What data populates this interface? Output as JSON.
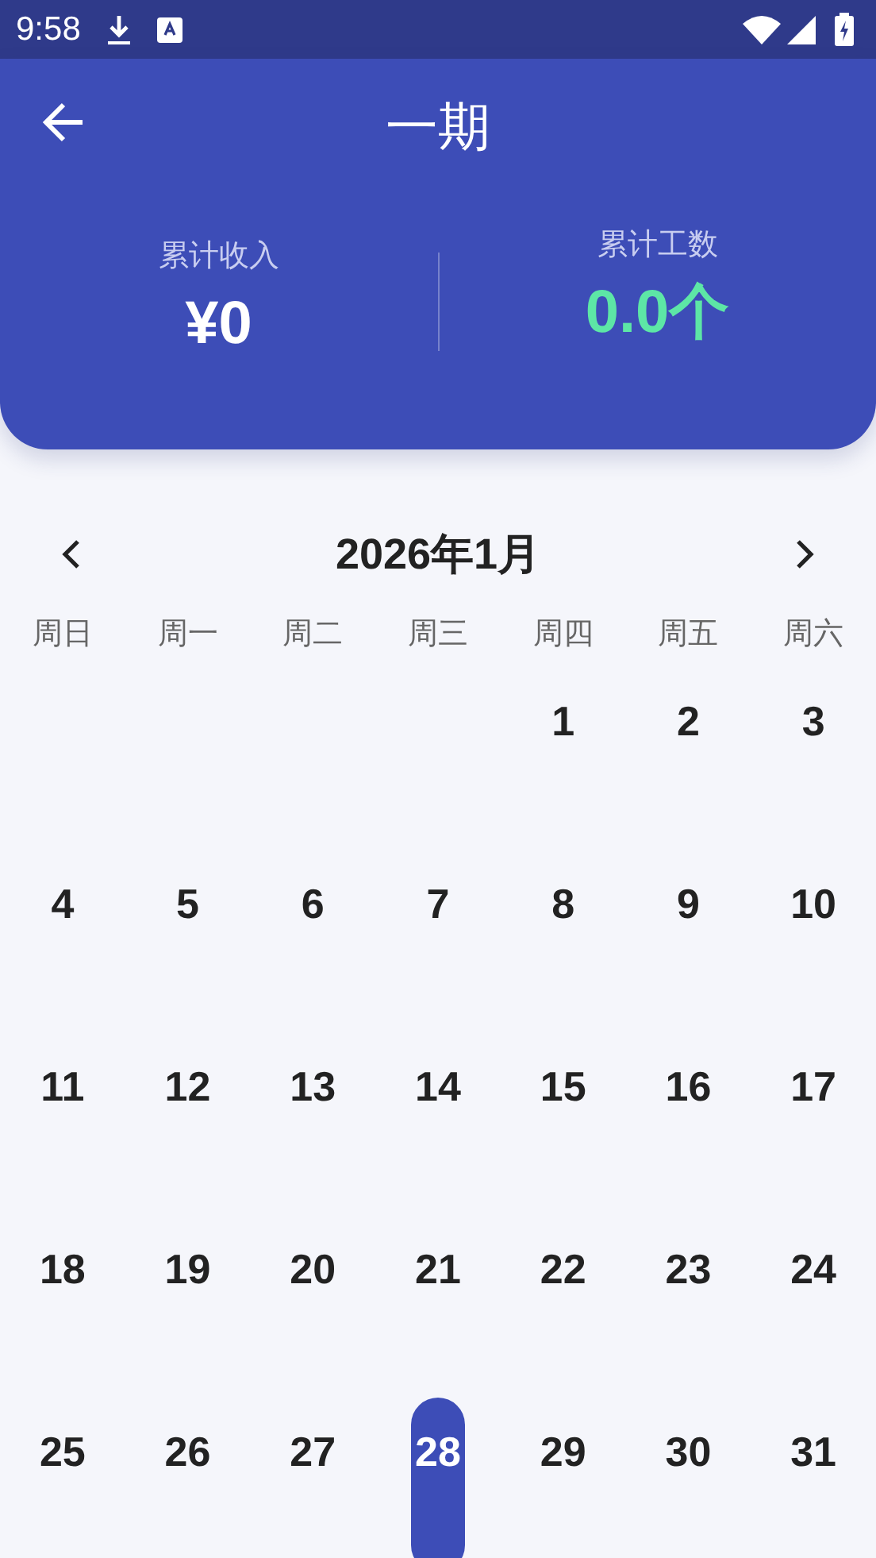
{
  "status_bar": {
    "time": "9:58"
  },
  "header": {
    "title": "一期"
  },
  "stats": [
    {
      "label": "累计收入",
      "value": "¥0",
      "kind": "income"
    },
    {
      "label": "累计工数",
      "value": "0.0个",
      "kind": "count"
    }
  ],
  "calendar": {
    "month": "2026年1月",
    "weekdays": [
      "周日",
      "周一",
      "周二",
      "周三",
      "周四",
      "周五",
      "周六"
    ],
    "days": [
      {
        "kind": "blank"
      },
      {
        "kind": "blank"
      },
      {
        "kind": "blank"
      },
      {
        "kind": "blank"
      },
      {
        "kind": "day",
        "label": "1",
        "selected": false
      },
      {
        "kind": "day",
        "label": "2",
        "selected": false
      },
      {
        "kind": "day",
        "label": "3",
        "selected": false
      },
      {
        "kind": "day",
        "label": "4",
        "selected": false
      },
      {
        "kind": "day",
        "label": "5",
        "selected": false
      },
      {
        "kind": "day",
        "label": "6",
        "selected": false
      },
      {
        "kind": "day",
        "label": "7",
        "selected": false
      },
      {
        "kind": "day",
        "label": "8",
        "selected": false
      },
      {
        "kind": "day",
        "label": "9",
        "selected": false
      },
      {
        "kind": "day",
        "label": "10",
        "selected": false
      },
      {
        "kind": "day",
        "label": "11",
        "selected": false
      },
      {
        "kind": "day",
        "label": "12",
        "selected": false
      },
      {
        "kind": "day",
        "label": "13",
        "selected": false
      },
      {
        "kind": "day",
        "label": "14",
        "selected": false
      },
      {
        "kind": "day",
        "label": "15",
        "selected": false
      },
      {
        "kind": "day",
        "label": "16",
        "selected": false
      },
      {
        "kind": "day",
        "label": "17",
        "selected": false
      },
      {
        "kind": "day",
        "label": "18",
        "selected": false
      },
      {
        "kind": "day",
        "label": "19",
        "selected": false
      },
      {
        "kind": "day",
        "label": "20",
        "selected": false
      },
      {
        "kind": "day",
        "label": "21",
        "selected": false
      },
      {
        "kind": "day",
        "label": "22",
        "selected": false
      },
      {
        "kind": "day",
        "label": "23",
        "selected": false
      },
      {
        "kind": "day",
        "label": "24",
        "selected": false
      },
      {
        "kind": "day",
        "label": "25",
        "selected": false
      },
      {
        "kind": "day",
        "label": "26",
        "selected": false
      },
      {
        "kind": "day",
        "label": "27",
        "selected": false
      },
      {
        "kind": "day",
        "label": "28",
        "selected": true
      },
      {
        "kind": "day",
        "label": "29",
        "selected": false
      },
      {
        "kind": "day",
        "label": "30",
        "selected": false
      },
      {
        "kind": "day",
        "label": "31",
        "selected": false
      }
    ]
  }
}
